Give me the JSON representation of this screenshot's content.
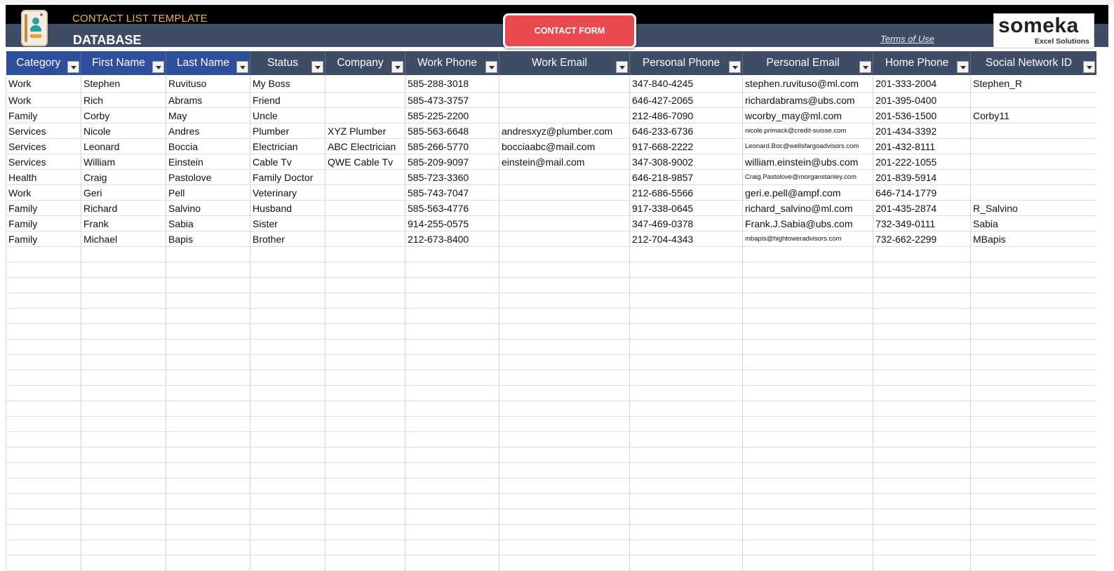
{
  "header": {
    "app_title": "CONTACT LIST TEMPLATE",
    "page_title": "DATABASE",
    "contact_form_button": "CONTACT FORM",
    "terms_link": "Terms of Use",
    "logo_wordmark": "someka",
    "logo_tagline": "Excel Solutions",
    "colors": {
      "title": "#f2b33d",
      "banner": "#3e4c66",
      "button": "#e94a4e",
      "header_blue": "#2f4e9c"
    }
  },
  "table": {
    "columns": [
      "Category",
      "First Name",
      "Last Name",
      "Status",
      "Company",
      "Work Phone",
      "Work Email",
      "Personal Phone",
      "Personal Email",
      "Home Phone",
      "Social Network ID"
    ],
    "rows": [
      [
        "Work",
        "Stephen",
        "Ruvituso",
        "My Boss",
        "",
        "585-288-3018",
        "",
        "347-840-4245",
        "stephen.ruvituso@ml.com",
        "201-333-2004",
        "Stephen_R"
      ],
      [
        "Work",
        "Rich",
        "Abrams",
        "Friend",
        "",
        "585-473-3757",
        "",
        "646-427-2065",
        "richardabrams@ubs.com",
        "201-395-0400",
        ""
      ],
      [
        "Family",
        "Corby",
        "May",
        "Uncle",
        "",
        "585-225-2200",
        "",
        "212-486-7090",
        "wcorby_may@ml.com",
        "201-536-1500",
        "Corby11"
      ],
      [
        "Services",
        "Nicole",
        "Andres",
        "Plumber",
        "XYZ Plumber",
        "585-563-6648",
        "andresxyz@plumber.com",
        "646-233-6736",
        "nicole.primack@credit-suisse.com",
        "201-434-3392",
        ""
      ],
      [
        "Services",
        "Leonard",
        "Boccia",
        "Electrician",
        "ABC Electrician",
        "585-266-5770",
        "bocciaabc@mail.com",
        "917-668-2222",
        "Leonard.Boc@wellsfargoadvisors.com",
        "201-432-8111",
        ""
      ],
      [
        "Services",
        "William",
        "Einstein",
        "Cable Tv",
        "QWE Cable Tv",
        "585-209-9097",
        "einstein@mail.com",
        "347-308-9002",
        "william.einstein@ubs.com",
        "201-222-1055",
        ""
      ],
      [
        "Health",
        "Craig",
        "Pastolove",
        "Family Doctor",
        "",
        "585-723-3360",
        "",
        "646-218-9857",
        "Craig.Pastolove@morganstanley.com",
        "201-839-5914",
        ""
      ],
      [
        "Work",
        "Geri",
        "Pell",
        "Veterinary",
        "",
        "585-743-7047",
        "",
        "212-686-5566",
        "geri.e.pell@ampf.com",
        "646-714-1779",
        ""
      ],
      [
        "Family",
        "Richard",
        "Salvino",
        "Husband",
        "",
        "585-563-4776",
        "",
        "917-338-0645",
        "richard_salvino@ml.com",
        "201-435-2874",
        "R_Salvino"
      ],
      [
        "Family",
        "Frank",
        "Sabia",
        "Sister",
        "",
        "914-255-0575",
        "",
        "347-469-0378",
        "Frank.J.Sabia@ubs.com",
        "732-349-0111",
        "Sabia"
      ],
      [
        "Family",
        "Michael",
        "Bapis",
        "Brother",
        "",
        "212-673-8400",
        "",
        "212-704-4343",
        "mbapis@hightoweradvisors.com",
        "732-662-2299",
        "MBapis"
      ]
    ]
  }
}
